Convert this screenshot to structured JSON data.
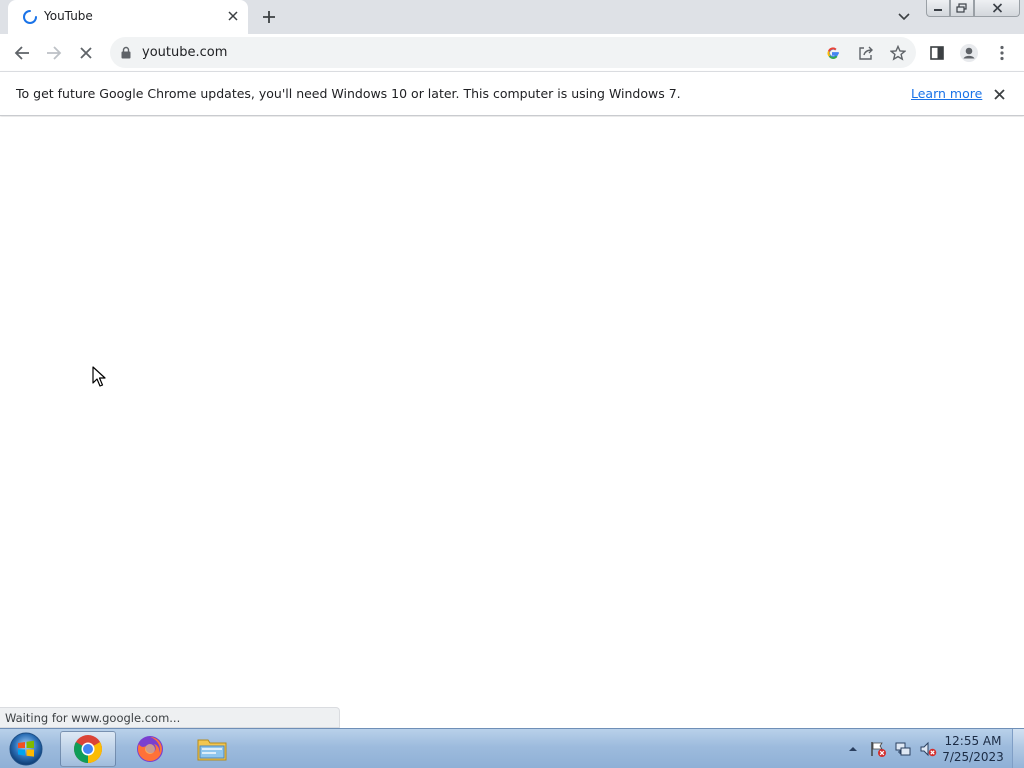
{
  "browser": {
    "tab": {
      "title": "YouTube"
    },
    "omnibox": {
      "url": "youtube.com"
    }
  },
  "infobar": {
    "message": "To get future Google Chrome updates, you'll need Windows 10 or later. This computer is using Windows 7.",
    "link_label": "Learn more"
  },
  "status_bar": {
    "text": "Waiting for www.google.com..."
  },
  "taskbar": {
    "apps": [
      "chrome-icon",
      "firefox-icon",
      "file-explorer-icon"
    ],
    "clock": {
      "time": "12:55 AM",
      "date": "7/25/2023"
    }
  },
  "colors": {
    "tab_strip": "#dee1e6",
    "link": "#1a73e8",
    "spinner": "#1a73e8",
    "taskbar": "#9dbbdd"
  }
}
